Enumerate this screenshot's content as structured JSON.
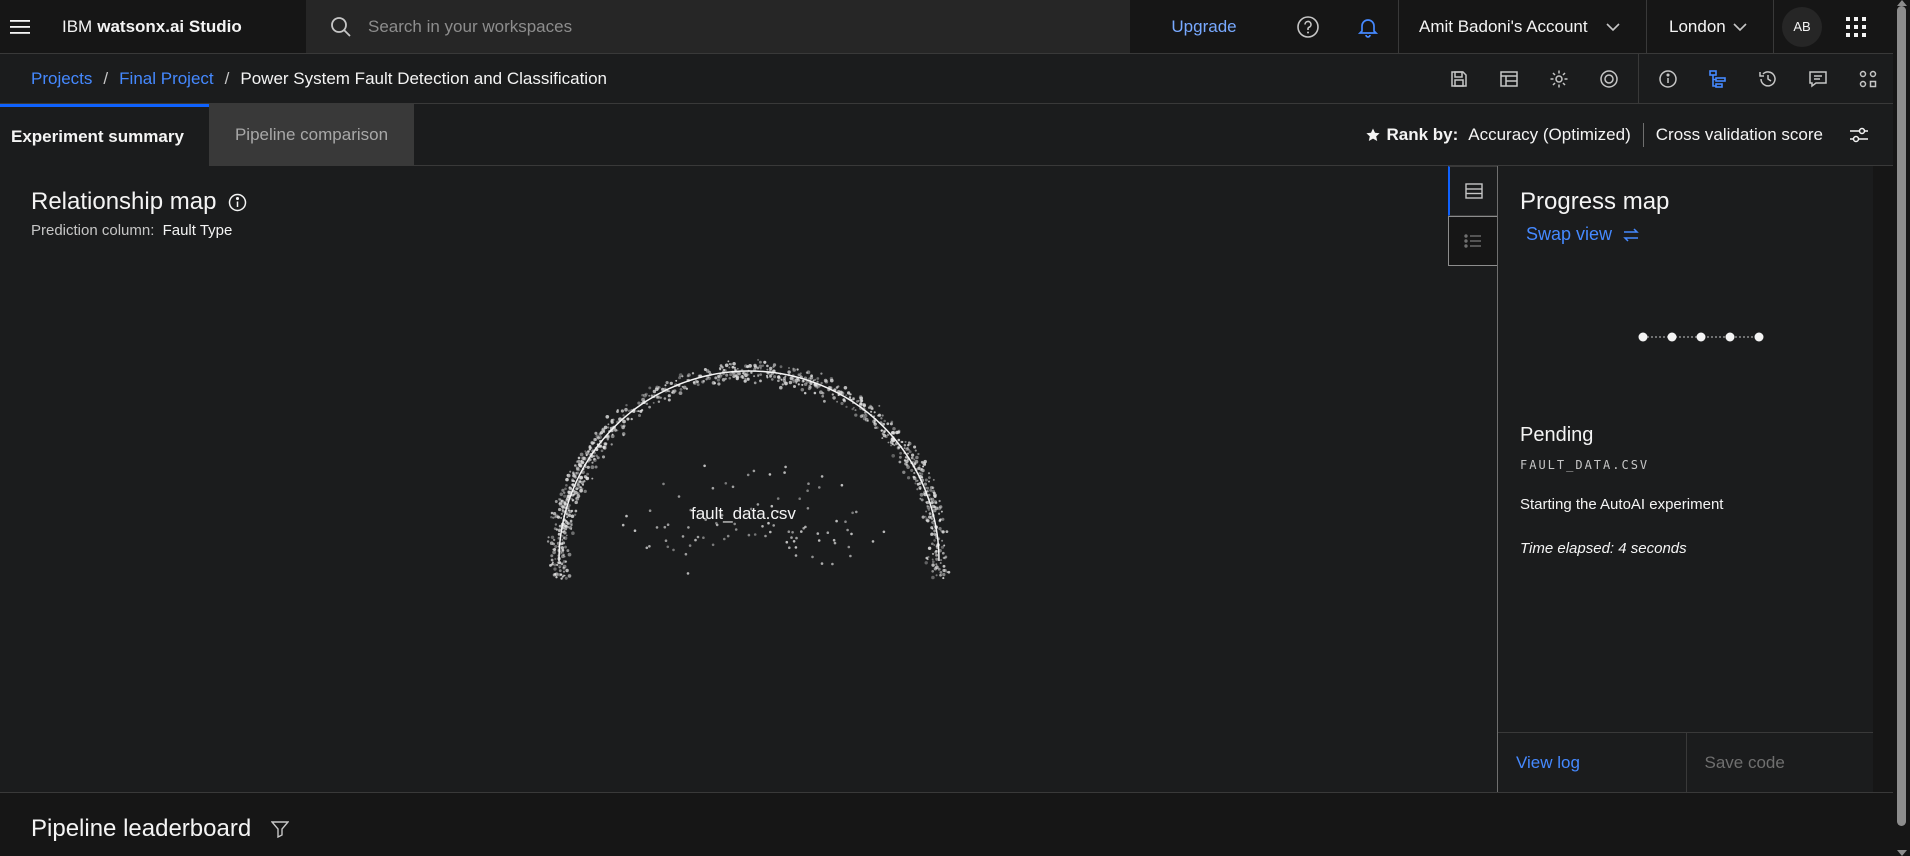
{
  "header": {
    "brand_prefix": "IBM",
    "brand_name": "watsonx.ai Studio",
    "search_placeholder": "Search in your workspaces",
    "upgrade_label": "Upgrade",
    "account_label": "Amit Badoni's Account",
    "region_label": "London",
    "avatar_initials": "AB"
  },
  "breadcrumb": {
    "items": [
      "Projects",
      "Final Project",
      "Power System Fault Detection and Classification"
    ],
    "separator": "/"
  },
  "toolbar_icons": [
    "save-icon",
    "data-table-icon",
    "settings-icon",
    "deploy-icon",
    "info-icon",
    "flow-icon",
    "history-icon",
    "chat-icon",
    "apps-icon"
  ],
  "tabs": {
    "experiment_summary": "Experiment summary",
    "pipeline_comparison": "Pipeline comparison"
  },
  "rank": {
    "label": "Rank by:",
    "metric": "Accuracy (Optimized)",
    "score_type": "Cross validation score"
  },
  "relationship_map": {
    "title": "Relationship map",
    "prediction_label": "Prediction column:",
    "prediction_value": "Fault Type",
    "dataset_label": "fault_data.csv"
  },
  "progress_map": {
    "title": "Progress map",
    "swap_label": "Swap view",
    "status": "Pending",
    "file_name": "FAULT_DATA.CSV",
    "message": "Starting the AutoAI experiment",
    "elapsed": "Time elapsed: 4 seconds",
    "view_log": "View log",
    "save_code": "Save code",
    "step_count": 5
  },
  "leaderboard": {
    "title": "Pipeline leaderboard"
  },
  "colors": {
    "accent": "#4589ff",
    "primary": "#0f62fe",
    "background": "#161616",
    "panel": "#1b1c1d"
  }
}
